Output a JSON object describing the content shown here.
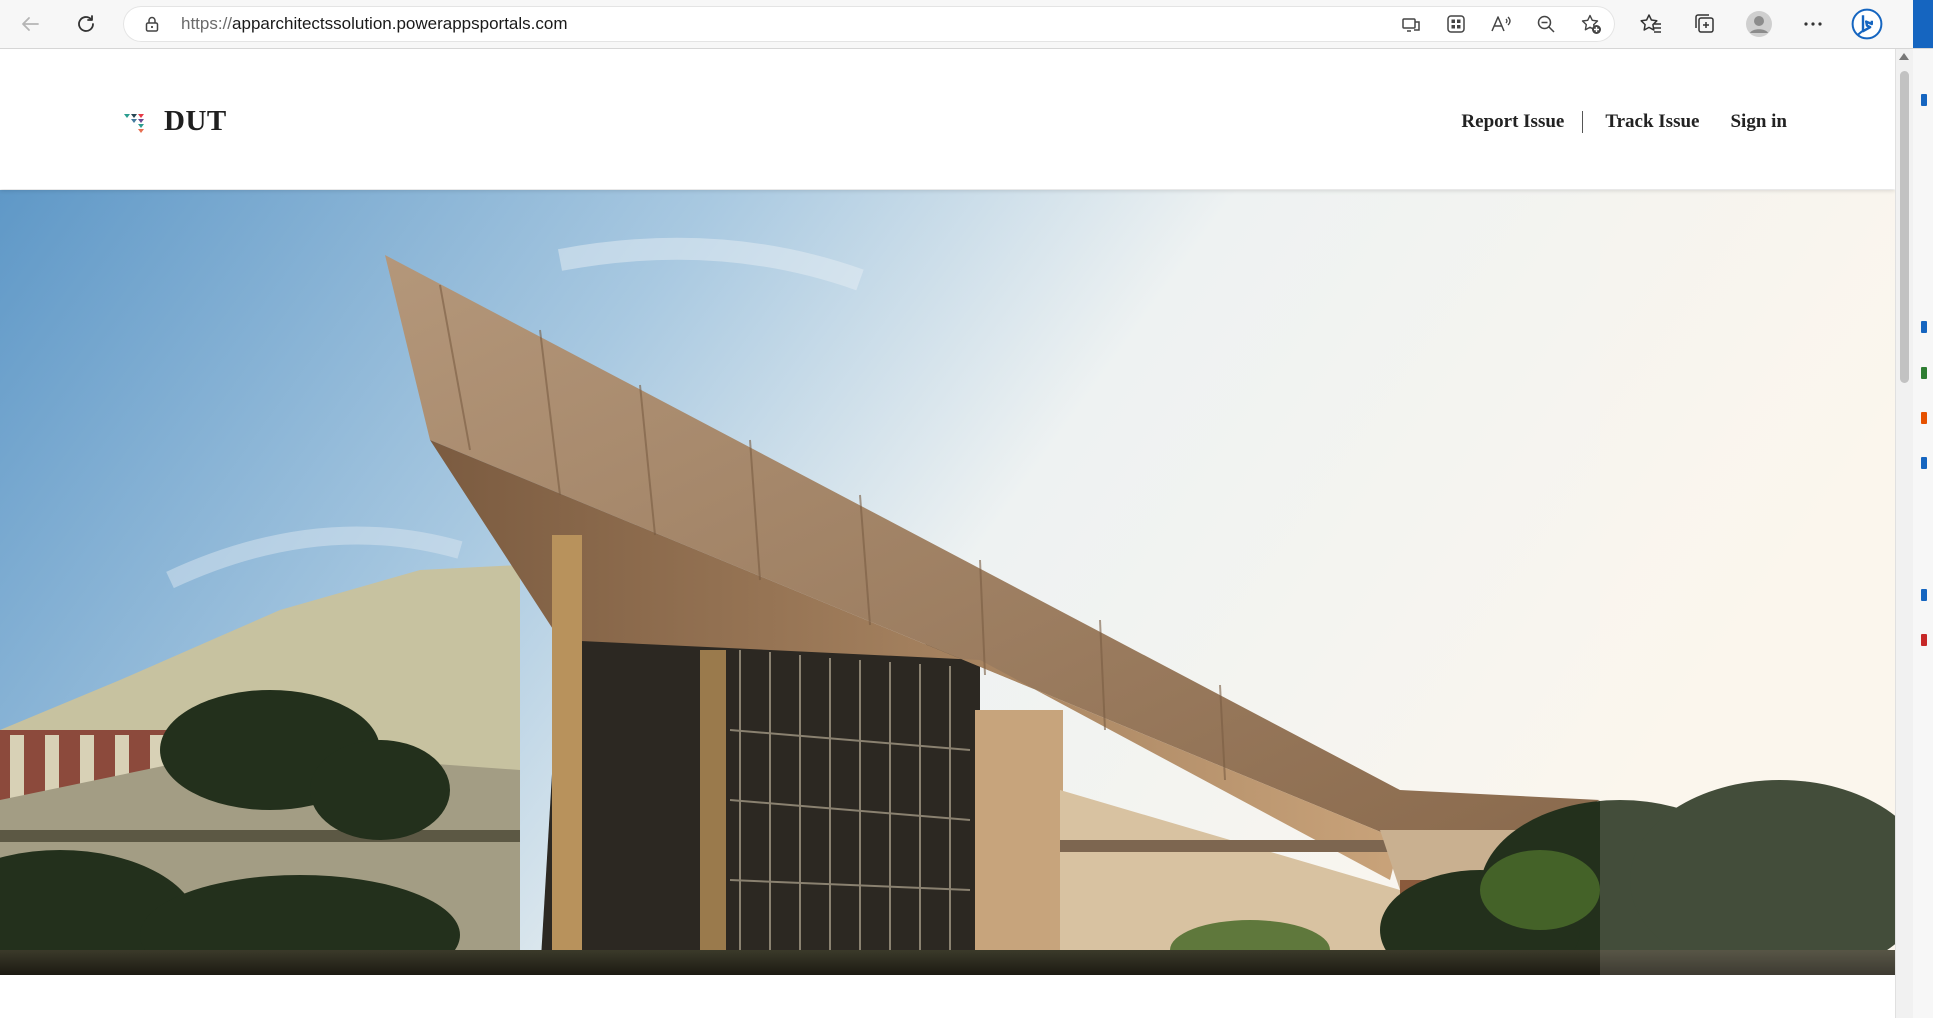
{
  "browser": {
    "url_scheme": "https://",
    "url_host": "apparchitectssolution.powerappsportals.com",
    "address_icons": [
      "immersive-reader-icon",
      "apps-icon",
      "read-aloud-icon",
      "zoom-out-icon",
      "add-favorite-icon"
    ],
    "toolbar_icons": [
      "favorites-icon",
      "collections-icon",
      "profile-avatar",
      "more-menu-icon",
      "bing-chat-icon"
    ]
  },
  "site": {
    "brand_name": "DUT",
    "nav": {
      "report_issue": "Report Issue",
      "track_issue": "Track Issue",
      "sign_in": "Sign in"
    }
  },
  "colors": {
    "accent": "#1565c0",
    "header_bg": "#ffffff",
    "nav_text": "#222222"
  }
}
